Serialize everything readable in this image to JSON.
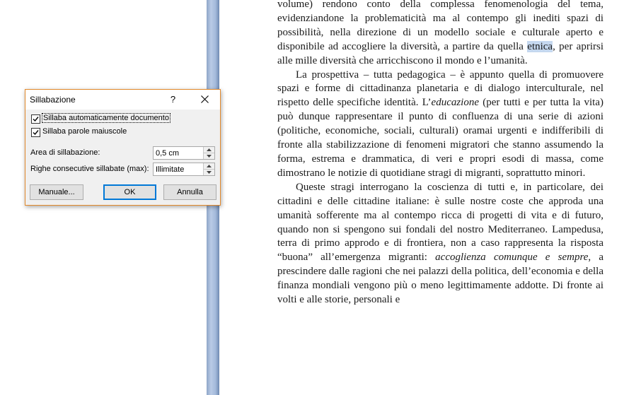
{
  "dialog": {
    "title": "Sillabazione",
    "help_label": "?",
    "auto_hyphenate_label": "Sillaba automaticamente documento",
    "auto_hyphenate_checked": true,
    "hyphenate_caps_label": "Sillaba parole maiuscole",
    "hyphenate_caps_checked": true,
    "zone_label": "Area di sillabazione:",
    "zone_value": "0,5 cm",
    "limit_label": "Righe consecutive sillabate (max):",
    "limit_value": "Illimitate",
    "manual_button": "Manuale...",
    "ok_button": "OK",
    "cancel_button": "Annulla"
  },
  "document": {
    "p1_a": "volume) rendono conto della complessa fenomenologia del tema, evidenziandone la problematicità ma al contempo gli inediti spazi di possibilità, nella direzione di un modello sociale e culturale aperto e disponibile ad accogliere la diversità, a partire da quella ",
    "p1_sel": "etnica",
    "p1_b": ", per aprirsi alle mille diversità che arricchiscono il mondo e l’umanità.",
    "p2_a": "La prospettiva – tutta pedagogica – è appunto quella di promuovere spazi e forme di cittadinanza planetaria e di dialogo interculturale, nel rispetto delle specifiche identità. L’",
    "p2_it": "educazione",
    "p2_b": " (per tutti e per tutta la vita) può dunque rappresentare il punto di confluenza di una serie di azioni (politiche, economiche, sociali, culturali) oramai urgenti e indifferibili di fronte alla stabilizzazione di fenomeni migratori che stanno assumendo la forma, estrema e drammatica, di veri e propri esodi di massa, come dimostrano le notizie di quotidiane stragi di migranti, soprattutto minori.",
    "p3_a": "Queste stragi interrogano la coscienza di tutti e, in particolare, dei cittadini e delle cittadine italiane: è sulle nostre coste che approda una umanità sofferente ma al contempo ricca di progetti di vita e di futuro, quando non si spengono sui fondali del nostro Mediterraneo. Lampedusa, terra di primo approdo e di frontiera, non a caso rappresenta la risposta “buona” all’emergenza migranti: ",
    "p3_it": "accoglienza comunque e sempre",
    "p3_b": ", a prescindere dalle ragioni che nei palazzi della politica, dell’economia e della finanza mondiali vengono più o meno legittimamente addotte. Di fronte ai volti e alle storie, personali e"
  },
  "colors": {
    "dialog_border": "#e2892b",
    "selection": "#c5d8ef",
    "ok_focus": "#0078d7",
    "ruler_bar": "#a4badb"
  },
  "icons": [
    "close-icon",
    "checkmark-icon",
    "spin-up-icon",
    "spin-down-icon"
  ]
}
